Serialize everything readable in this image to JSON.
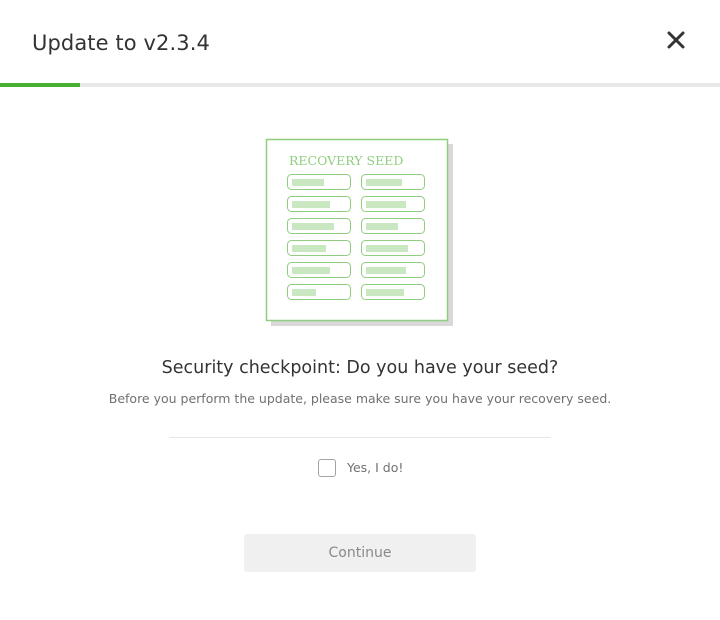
{
  "modal": {
    "title": "Update to v2.3.4",
    "progress_fraction": 0.111,
    "accent_color": "#47b034"
  },
  "illustration": {
    "label": "RECOVERY SEED",
    "icon": "recovery-seed-card-icon",
    "line_color": "#8fce7f",
    "fill_color": "#c9e8c1"
  },
  "checkpoint": {
    "heading": "Security checkpoint: Do you have your seed?",
    "description": "Before you perform the update, please make sure you have your recovery seed.",
    "checkbox_label": "Yes, I do!",
    "checkbox_checked": false
  },
  "actions": {
    "continue_label": "Continue",
    "continue_enabled": false
  },
  "icons": {
    "close": "close-icon"
  }
}
